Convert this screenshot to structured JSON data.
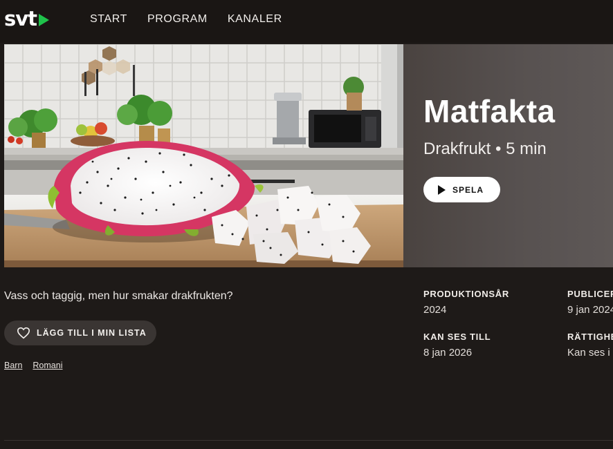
{
  "header": {
    "logo_text": "svt",
    "nav": [
      {
        "label": "START"
      },
      {
        "label": "PROGRAM"
      },
      {
        "label": "KANALER"
      }
    ]
  },
  "hero": {
    "title": "Matfakta",
    "subtitle": "Drakfrukt • 5 min",
    "play_label": "SPELA"
  },
  "details": {
    "description": "Vass och taggig, men hur smakar drakfrukten?",
    "add_to_list_label": "LÄGG TILL I MIN LISTA",
    "tags": [
      "Barn",
      "Romani"
    ],
    "meta": [
      {
        "label": "PRODUKTIONSÅR",
        "value": "2024"
      },
      {
        "label": "KAN SES TILL",
        "value": "8 jan 2026"
      },
      {
        "label": "PUBLICER",
        "value": "9 jan 2024"
      },
      {
        "label": "RÄTTIGHE",
        "value": "Kan ses i"
      }
    ]
  },
  "colors": {
    "accent": "#1fc24b",
    "background": "#1e1a18",
    "button_bg": "#3a3533"
  }
}
